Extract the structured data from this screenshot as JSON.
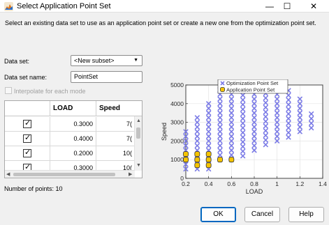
{
  "window": {
    "title": "Select Application Point Set",
    "minimize_glyph": "—",
    "maximize_glyph": "☐",
    "close_glyph": "✕"
  },
  "description": "Select an existing data set to use as an application point set or create a new one from the optimization point set.",
  "form": {
    "data_set_label": "Data set:",
    "data_set_value": "<New subset>",
    "data_set_name_label": "Data set name:",
    "data_set_name_value": "PointSet",
    "interpolate_label": "Interpolate for each mode",
    "interpolate_checked": false
  },
  "table": {
    "columns": [
      "",
      "LOAD",
      "Speed"
    ],
    "rows": [
      {
        "checked": true,
        "load": "0.3000",
        "speed": "7("
      },
      {
        "checked": true,
        "load": "0.4000",
        "speed": "7("
      },
      {
        "checked": true,
        "load": "0.2000",
        "speed": "10("
      },
      {
        "checked": true,
        "load": "0.3000",
        "speed": "10("
      }
    ]
  },
  "num_points_label": "Number of points: 10",
  "buttons": {
    "ok": "OK",
    "cancel": "Cancel",
    "help": "Help"
  },
  "colors": {
    "optimization_marker": "#7b7be6",
    "application_marker_fill": "#f5c400",
    "application_marker_edge": "#333333"
  },
  "chart_data": {
    "type": "scatter",
    "xlabel": "LOAD",
    "ylabel": "Speed",
    "xlim": [
      0.2,
      1.4
    ],
    "ylim": [
      0,
      5000
    ],
    "xticks": [
      "0.2",
      "0.4",
      "0.6",
      "0.8",
      "1",
      "1.2",
      "1.4"
    ],
    "yticks": [
      "0",
      "1000",
      "2000",
      "3000",
      "4000",
      "5000"
    ],
    "grid": true,
    "legend_position": "top",
    "series": [
      {
        "name": "Optimization Point Set",
        "marker": "x",
        "columns": [
          {
            "x": 0.2,
            "ymin": 500,
            "ymax": 2600
          },
          {
            "x": 0.3,
            "ymin": 500,
            "ymax": 3400
          },
          {
            "x": 0.4,
            "ymin": 500,
            "ymax": 4000
          },
          {
            "x": 0.5,
            "ymin": 1000,
            "ymax": 4800
          },
          {
            "x": 0.6,
            "ymin": 1000,
            "ymax": 4800
          },
          {
            "x": 0.7,
            "ymin": 1200,
            "ymax": 4800
          },
          {
            "x": 0.8,
            "ymin": 1500,
            "ymax": 4800
          },
          {
            "x": 0.9,
            "ymin": 1800,
            "ymax": 4800
          },
          {
            "x": 1.0,
            "ymin": 2000,
            "ymax": 4800
          },
          {
            "x": 1.1,
            "ymin": 2200,
            "ymax": 4800
          },
          {
            "x": 1.2,
            "ymin": 2500,
            "ymax": 4300
          },
          {
            "x": 1.3,
            "ymin": 2700,
            "ymax": 3600
          }
        ]
      },
      {
        "name": "Application Point Set",
        "marker": "o",
        "x": [
          0.2,
          0.2,
          0.3,
          0.3,
          0.3,
          0.4,
          0.4,
          0.4,
          0.5,
          0.6
        ],
        "y": [
          1000,
          1300,
          700,
          1000,
          1300,
          700,
          1000,
          1300,
          1000,
          1000
        ]
      }
    ]
  }
}
